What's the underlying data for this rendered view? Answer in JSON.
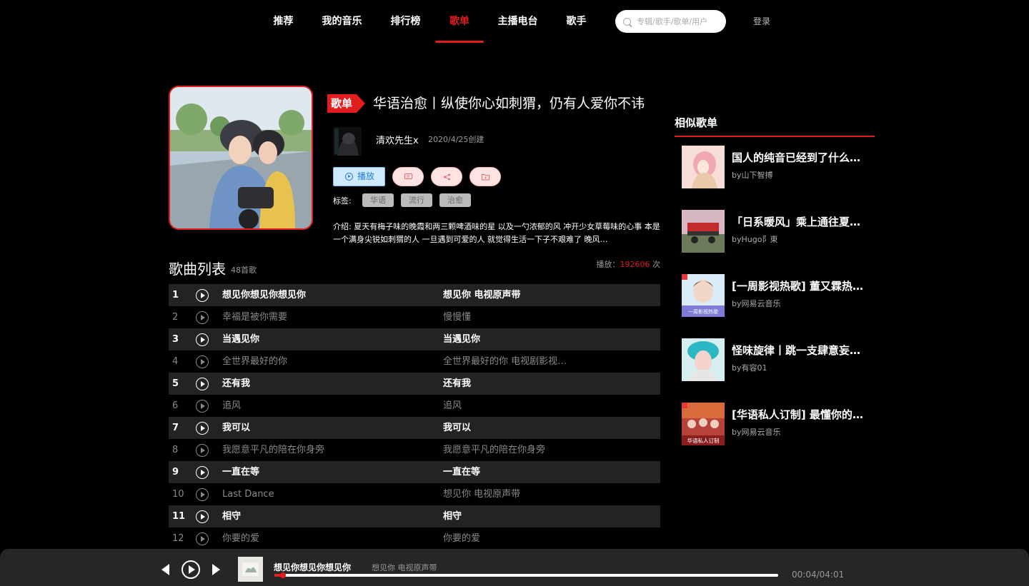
{
  "nav": {
    "items": [
      {
        "label": "推荐",
        "active": false
      },
      {
        "label": "我的音乐",
        "active": false
      },
      {
        "label": "排行榜",
        "active": false
      },
      {
        "label": "歌单",
        "active": true
      },
      {
        "label": "主播电台",
        "active": false
      },
      {
        "label": "歌手",
        "active": false
      }
    ],
    "search_placeholder": "专辑/歌手/歌单/用户",
    "login": "登录"
  },
  "playlist": {
    "type_label": "歌单",
    "title": "华语治愈丨纵使你心如刺猬，仍有人爱你不讳",
    "creator": "清欢先生x",
    "created": "2020/4/25创建",
    "play_label": "播放",
    "tags_title": "标签:",
    "tags": [
      "华语",
      "流行",
      "治愈"
    ],
    "description": "介绍: 夏天有梅子味的晚霞和两三颗啤酒味的星 以及一勺浓郁的风 冲开少女草莓味的心事 本是一个满身尖锐如刺猬的人 一旦遇到可爱的人 就觉得生活一下子不艰难了 晚风…"
  },
  "song_list": {
    "title": "歌曲列表",
    "count": "48首歌",
    "plays_prefix": "播放：",
    "plays": "192606",
    "plays_suffix": " 次",
    "songs": [
      {
        "index": "1",
        "name": "想见你想见你想见你",
        "album": "想见你 电视原声带"
      },
      {
        "index": "2",
        "name": "幸福是被你需要",
        "album": "慢慢懂"
      },
      {
        "index": "3",
        "name": "当遇见你",
        "album": "当遇见你"
      },
      {
        "index": "4",
        "name": "全世界最好的你",
        "album": "全世界最好的你 电视剧影视…"
      },
      {
        "index": "5",
        "name": "还有我",
        "album": "还有我"
      },
      {
        "index": "6",
        "name": "追风",
        "album": "追风"
      },
      {
        "index": "7",
        "name": "我可以",
        "album": "我可以"
      },
      {
        "index": "8",
        "name": "我愿意平凡的陪在你身旁",
        "album": "我愿意平凡的陪在你身旁"
      },
      {
        "index": "9",
        "name": "一直在等",
        "album": "一直在等"
      },
      {
        "index": "10",
        "name": "Last Dance",
        "album": "想见你 电视原声带"
      },
      {
        "index": "11",
        "name": "相守",
        "album": "相守"
      },
      {
        "index": "12",
        "name": "你要的爱",
        "album": "你要的爱"
      }
    ]
  },
  "similar": {
    "title": "相似歌单",
    "items": [
      {
        "title": "国人的纯音已经到了什么地步",
        "by": "by山下智搏",
        "thumb_color": "#f3c7c5"
      },
      {
        "title": "「日系暖风」乘上通往夏天的列车",
        "by": "byHugo阝東",
        "thumb_color": "#c9a6b7"
      },
      {
        "title": "[一周影视热歌] 董又霖热门单曲",
        "by": "by网易云音乐",
        "thumb_color": "#cfe4f2"
      },
      {
        "title": "怪味旋律丨跳一支肆意妄为的舞",
        "by": "by有容01",
        "thumb_color": "#79c4c8"
      },
      {
        "title": "[华语私人订制] 最懂你的华语推荐",
        "by": "by网易云音乐",
        "thumb_color": "#b8423a"
      }
    ],
    "thumb_texts": [
      "一周影视热歌",
      "华语私人订制"
    ]
  },
  "player": {
    "title": "想见你想见你想见你",
    "album": "想见你 电视原声带",
    "time": "00:04/04:01",
    "progress": 0.0166
  },
  "colors": {
    "accent": "#e21d1d",
    "background": "#000000",
    "row_alt": "#232323",
    "player_bg": "#262626"
  }
}
